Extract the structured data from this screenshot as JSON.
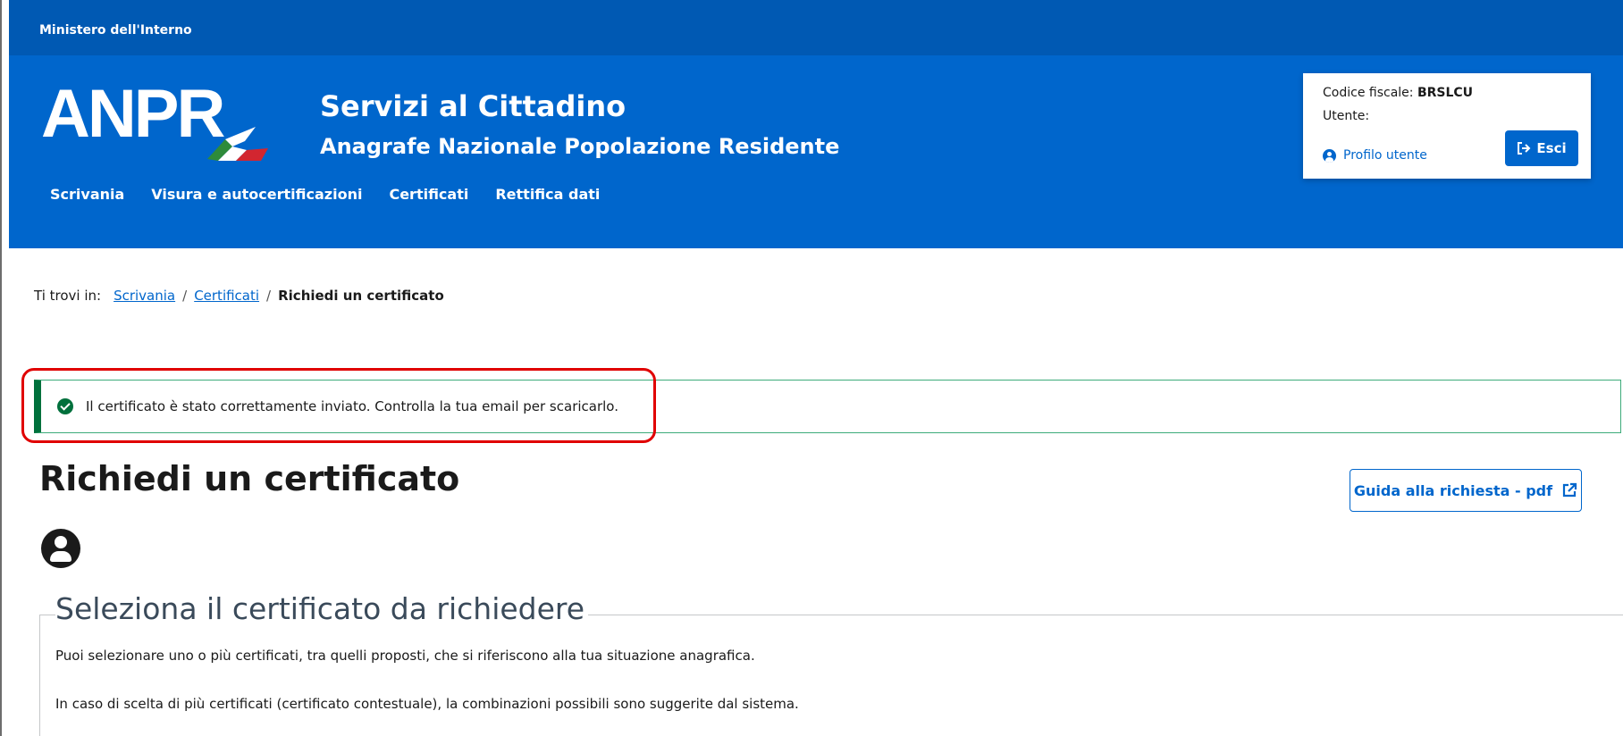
{
  "ministry": {
    "label": "Ministero dell'Interno"
  },
  "header": {
    "logo_text": "ANPR",
    "title": "Servizi al Cittadino",
    "subtitle": "Anagrafe Nazionale Popolazione Residente"
  },
  "user": {
    "cf_label": "Codice fiscale:",
    "cf_value": "BRSLCU",
    "utente_label": "Utente:",
    "profilo_label": "Profilo utente",
    "esci_label": "Esci"
  },
  "nav": {
    "items": [
      {
        "label": "Scrivania"
      },
      {
        "label": "Visura e autocertificazioni"
      },
      {
        "label": "Certificati"
      },
      {
        "label": "Rettifica dati"
      }
    ]
  },
  "breadcrumb": {
    "prefix": "Ti trovi in:",
    "items": [
      {
        "label": "Scrivania"
      },
      {
        "label": "Certificati"
      }
    ],
    "current": "Richiedi un certificato",
    "separator": "/"
  },
  "alert": {
    "message": "Il certificato è stato correttamente inviato. Controlla la tua email per scaricarlo.",
    "color": "#00703c"
  },
  "main": {
    "title": "Richiedi un certificato",
    "guida_label": "Guida alla richiesta - pdf",
    "section_title": "Seleziona il certificato da richiedere",
    "desc1": "Puoi selezionare uno o più certificati, tra quelli proposti, che si riferiscono alla tua situazione anagrafica.",
    "desc2": "In caso di scelta di più certificati (certificato contestuale), la combinazioni possibili sono suggerite dal sistema."
  },
  "colors": {
    "primary": "#0066cc",
    "ministry_bar": "#0059b3",
    "highlight": "#e00000"
  }
}
